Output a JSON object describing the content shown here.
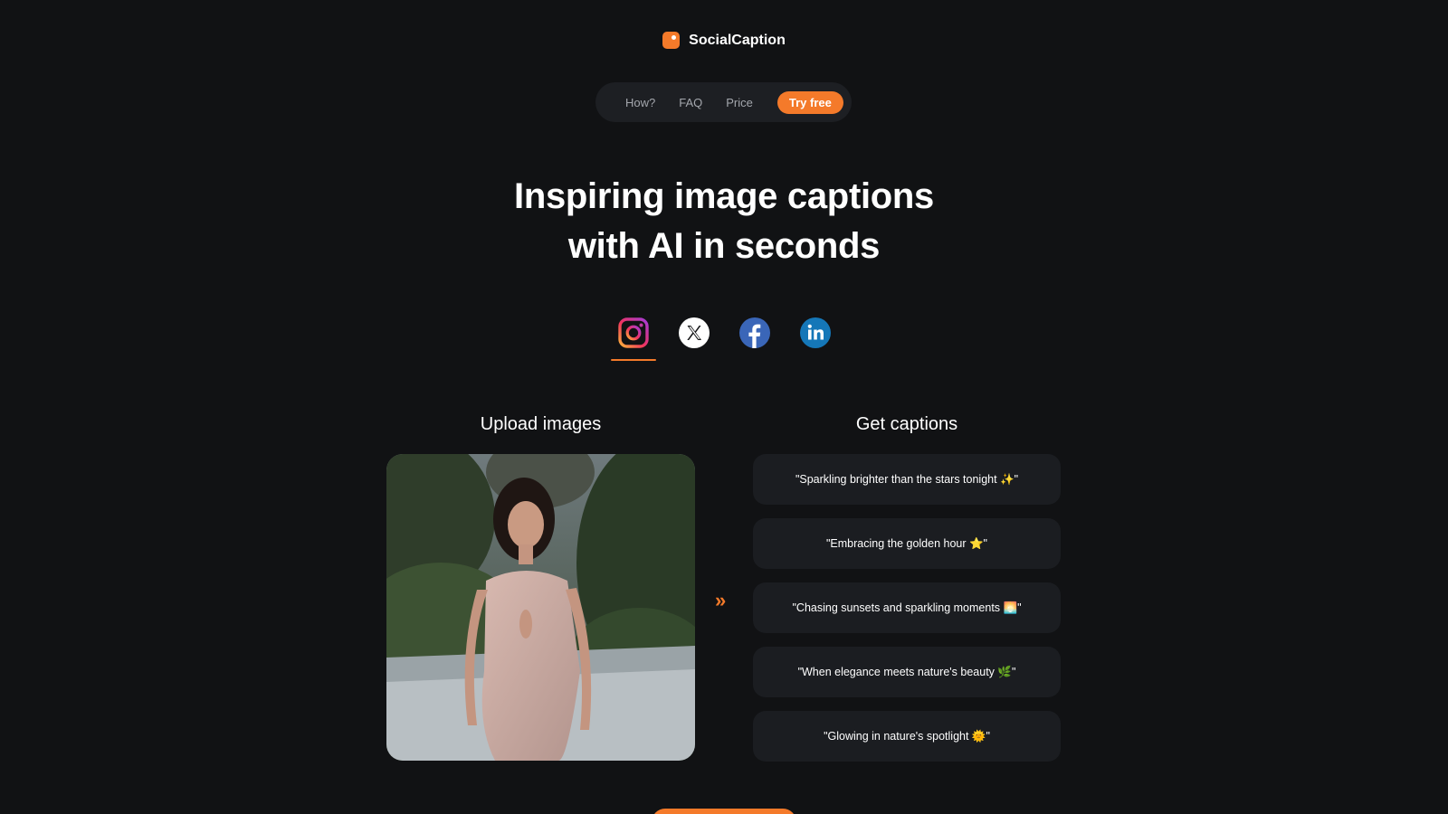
{
  "brand": {
    "name": "SocialCaption",
    "logo_icon": "speech-bubble-logo",
    "accent_color": "#f47a2a"
  },
  "nav": {
    "links": [
      "How?",
      "FAQ",
      "Price"
    ],
    "cta_label": "Try free"
  },
  "hero": {
    "line1": "Inspiring image captions",
    "line2": "with AI in seconds"
  },
  "platforms": [
    {
      "name": "Instagram",
      "icon": "instagram-icon",
      "active": true
    },
    {
      "name": "X",
      "icon": "x-icon",
      "active": false
    },
    {
      "name": "Facebook",
      "icon": "facebook-icon",
      "active": false
    },
    {
      "name": "LinkedIn",
      "icon": "linkedin-icon",
      "active": false
    }
  ],
  "upload": {
    "title": "Upload images"
  },
  "output": {
    "title": "Get captions",
    "captions": [
      "\"Sparkling brighter than the stars tonight ✨\"",
      "\"Embracing the golden hour ⭐\"",
      "\"Chasing sunsets and sparkling moments 🌅\"",
      "\"When elegance meets nature's beauty 🌿\"",
      "\"Glowing in nature's spotlight 🌞\""
    ]
  },
  "arrow_icon": "double-chevron-right-icon"
}
